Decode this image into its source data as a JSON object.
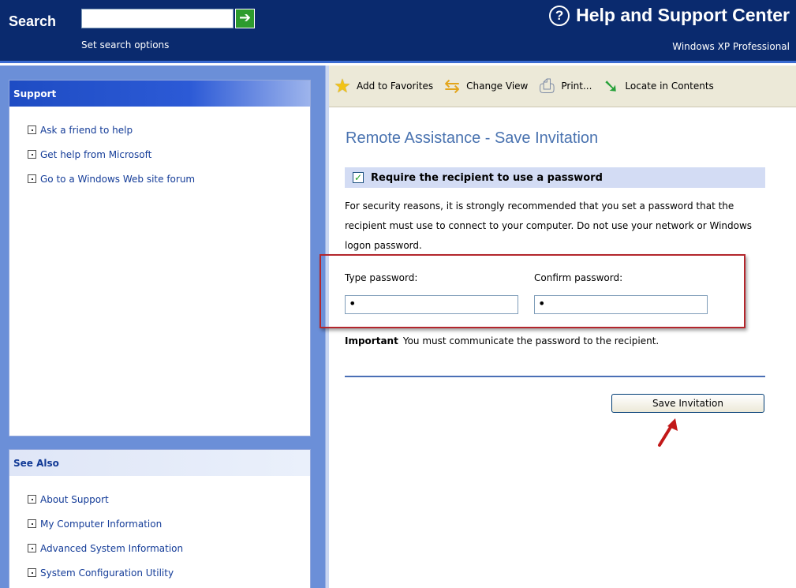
{
  "header": {
    "search_label": "Search",
    "search_value": "",
    "go_icon": "arrow-right-icon",
    "search_options": "Set search options",
    "title": "Help and Support Center",
    "title_icon": "question-circle-icon",
    "edition": "Windows XP Professional"
  },
  "support": {
    "heading": "Support",
    "items": [
      {
        "label": "Ask a friend to help"
      },
      {
        "label": "Get help from Microsoft"
      },
      {
        "label": "Go to a Windows Web site forum"
      }
    ]
  },
  "see_also": {
    "heading": "See Also",
    "items": [
      {
        "label": "About Support"
      },
      {
        "label": "My Computer Information"
      },
      {
        "label": "Advanced System Information"
      },
      {
        "label": "System Configuration Utility"
      }
    ]
  },
  "toolbar": {
    "add_favorites": "Add to Favorites",
    "change_view": "Change View",
    "print": "Print...",
    "locate": "Locate in Contents"
  },
  "main": {
    "title": "Remote Assistance - Save Invitation",
    "require_label": "Require the recipient to use a password",
    "require_checked": true,
    "description": "For security reasons, it is strongly recommended that you set a password that the recipient must use to connect to your computer. Do not use your network or Windows logon password.",
    "type_password_label": "Type password:",
    "confirm_password_label": "Confirm password:",
    "type_password_value": "•",
    "confirm_password_value": "•",
    "important_label": "Important",
    "important_text": "You must communicate the password to the recipient.",
    "save_button": "Save Invitation"
  },
  "colors": {
    "header_bg": "#0a2a6e",
    "title_color": "#4a73b0",
    "highlight_border": "#b3262c",
    "link_color": "#143c98"
  }
}
